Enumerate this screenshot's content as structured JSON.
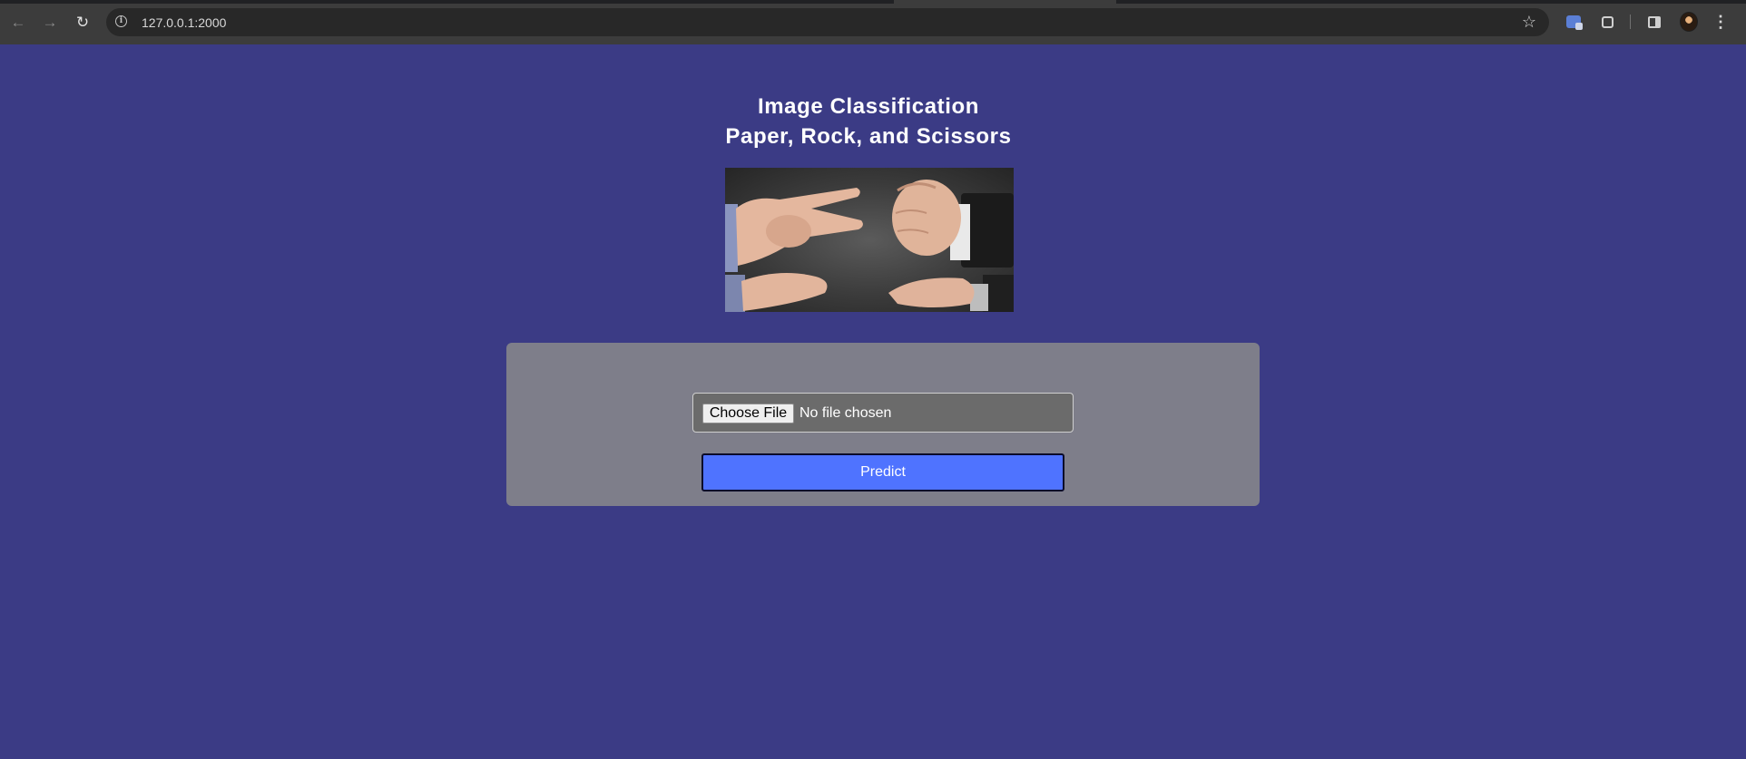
{
  "browser": {
    "url": "127.0.0.1:2000",
    "nav": {
      "back_icon": "←",
      "forward_icon": "→",
      "reload_icon": "↻"
    },
    "star_icon": "☆",
    "site_info_icon": "i",
    "menu_icon": "⋮"
  },
  "page": {
    "title_line1": "Image Classification",
    "title_line2": "Paper, Rock, and Scissors",
    "background_color": "#3b3b85"
  },
  "form": {
    "choose_file_label": "Choose File",
    "file_status": "No file chosen",
    "predict_label": "Predict",
    "predict_color": "#4f73ff"
  }
}
